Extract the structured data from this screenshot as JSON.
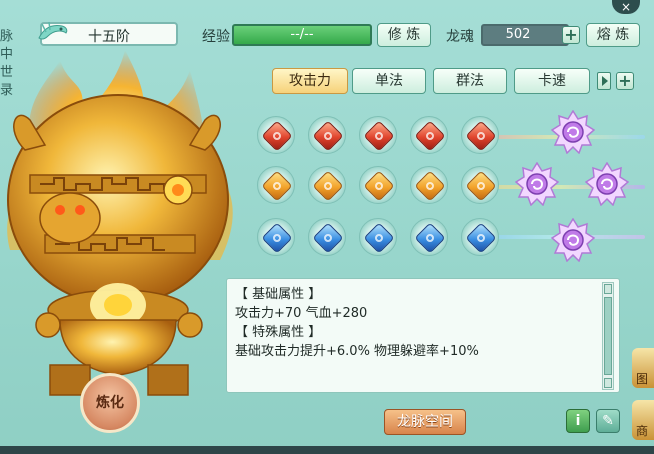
{
  "window": {
    "side_tab_chars": [
      "脉",
      "中",
      "世",
      "录"
    ],
    "rank_label": "十五阶",
    "exp_label": "经验",
    "exp_value": "--/--",
    "cultivate_button": "修 炼",
    "soul_label": "龙魂",
    "soul_value": "502",
    "smelt_button": "熔 炼",
    "close_label": "×"
  },
  "tabs": [
    {
      "label": "攻击力",
      "active": true
    },
    {
      "label": "单法",
      "active": false
    },
    {
      "label": "群法",
      "active": false
    },
    {
      "label": "卡速",
      "active": false
    }
  ],
  "gems": {
    "rows": [
      [
        "red",
        "red",
        "red",
        "red",
        "red"
      ],
      [
        "orange",
        "orange",
        "orange",
        "orange",
        "orange"
      ],
      [
        "blue",
        "blue",
        "blue",
        "blue",
        "blue"
      ]
    ],
    "special_star_gems": 4
  },
  "attributes": {
    "base_header": "【 基础属性 】",
    "base_values": "攻击力+70 气血+280",
    "special_header": "【 特殊属性 】",
    "special_values": "基础攻击力提升+6.0% 物理躲避率+10%"
  },
  "buttons": {
    "refine": "炼化",
    "dragon_space": "龙脉空间",
    "info_icon": "i",
    "edit_icon": "✎"
  },
  "side_icons": [
    "图",
    "商"
  ],
  "colors": {
    "background": "#a5ded6",
    "active_tab": "#f6d27a",
    "exp_bar": "#35a94a",
    "dragon_space_button": "#d8844b"
  }
}
